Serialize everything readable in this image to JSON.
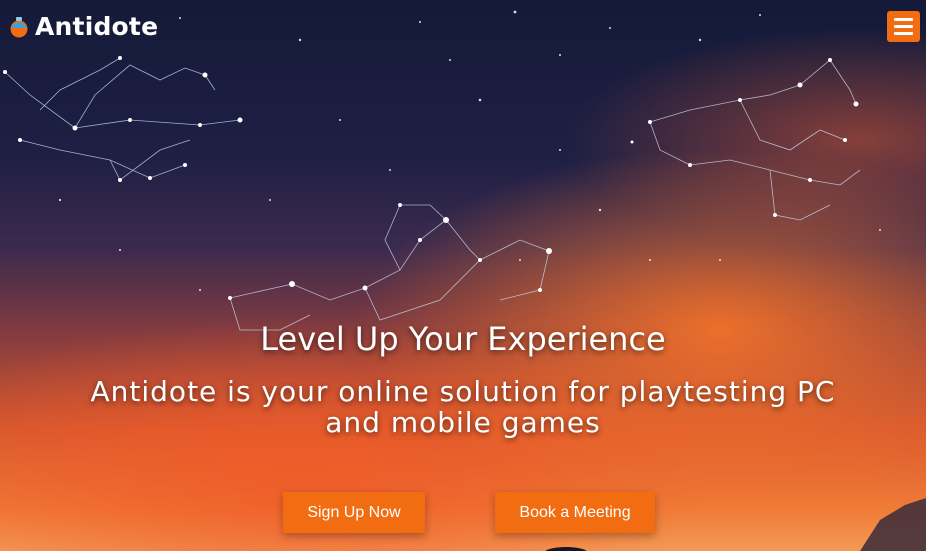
{
  "brand": {
    "name": "Antidote",
    "logo_icon": "potion-flask-icon",
    "accent_color": "#f26d12"
  },
  "header": {
    "menu_icon": "hamburger-menu-icon"
  },
  "hero": {
    "headline": "Level Up Your Experience",
    "subheadline": "Antidote is your online solution for playtesting PC and mobile games",
    "background": "constellation-night-sky"
  },
  "actions": {
    "signup_label": "Sign Up Now",
    "meeting_label": "Book a Meeting"
  }
}
